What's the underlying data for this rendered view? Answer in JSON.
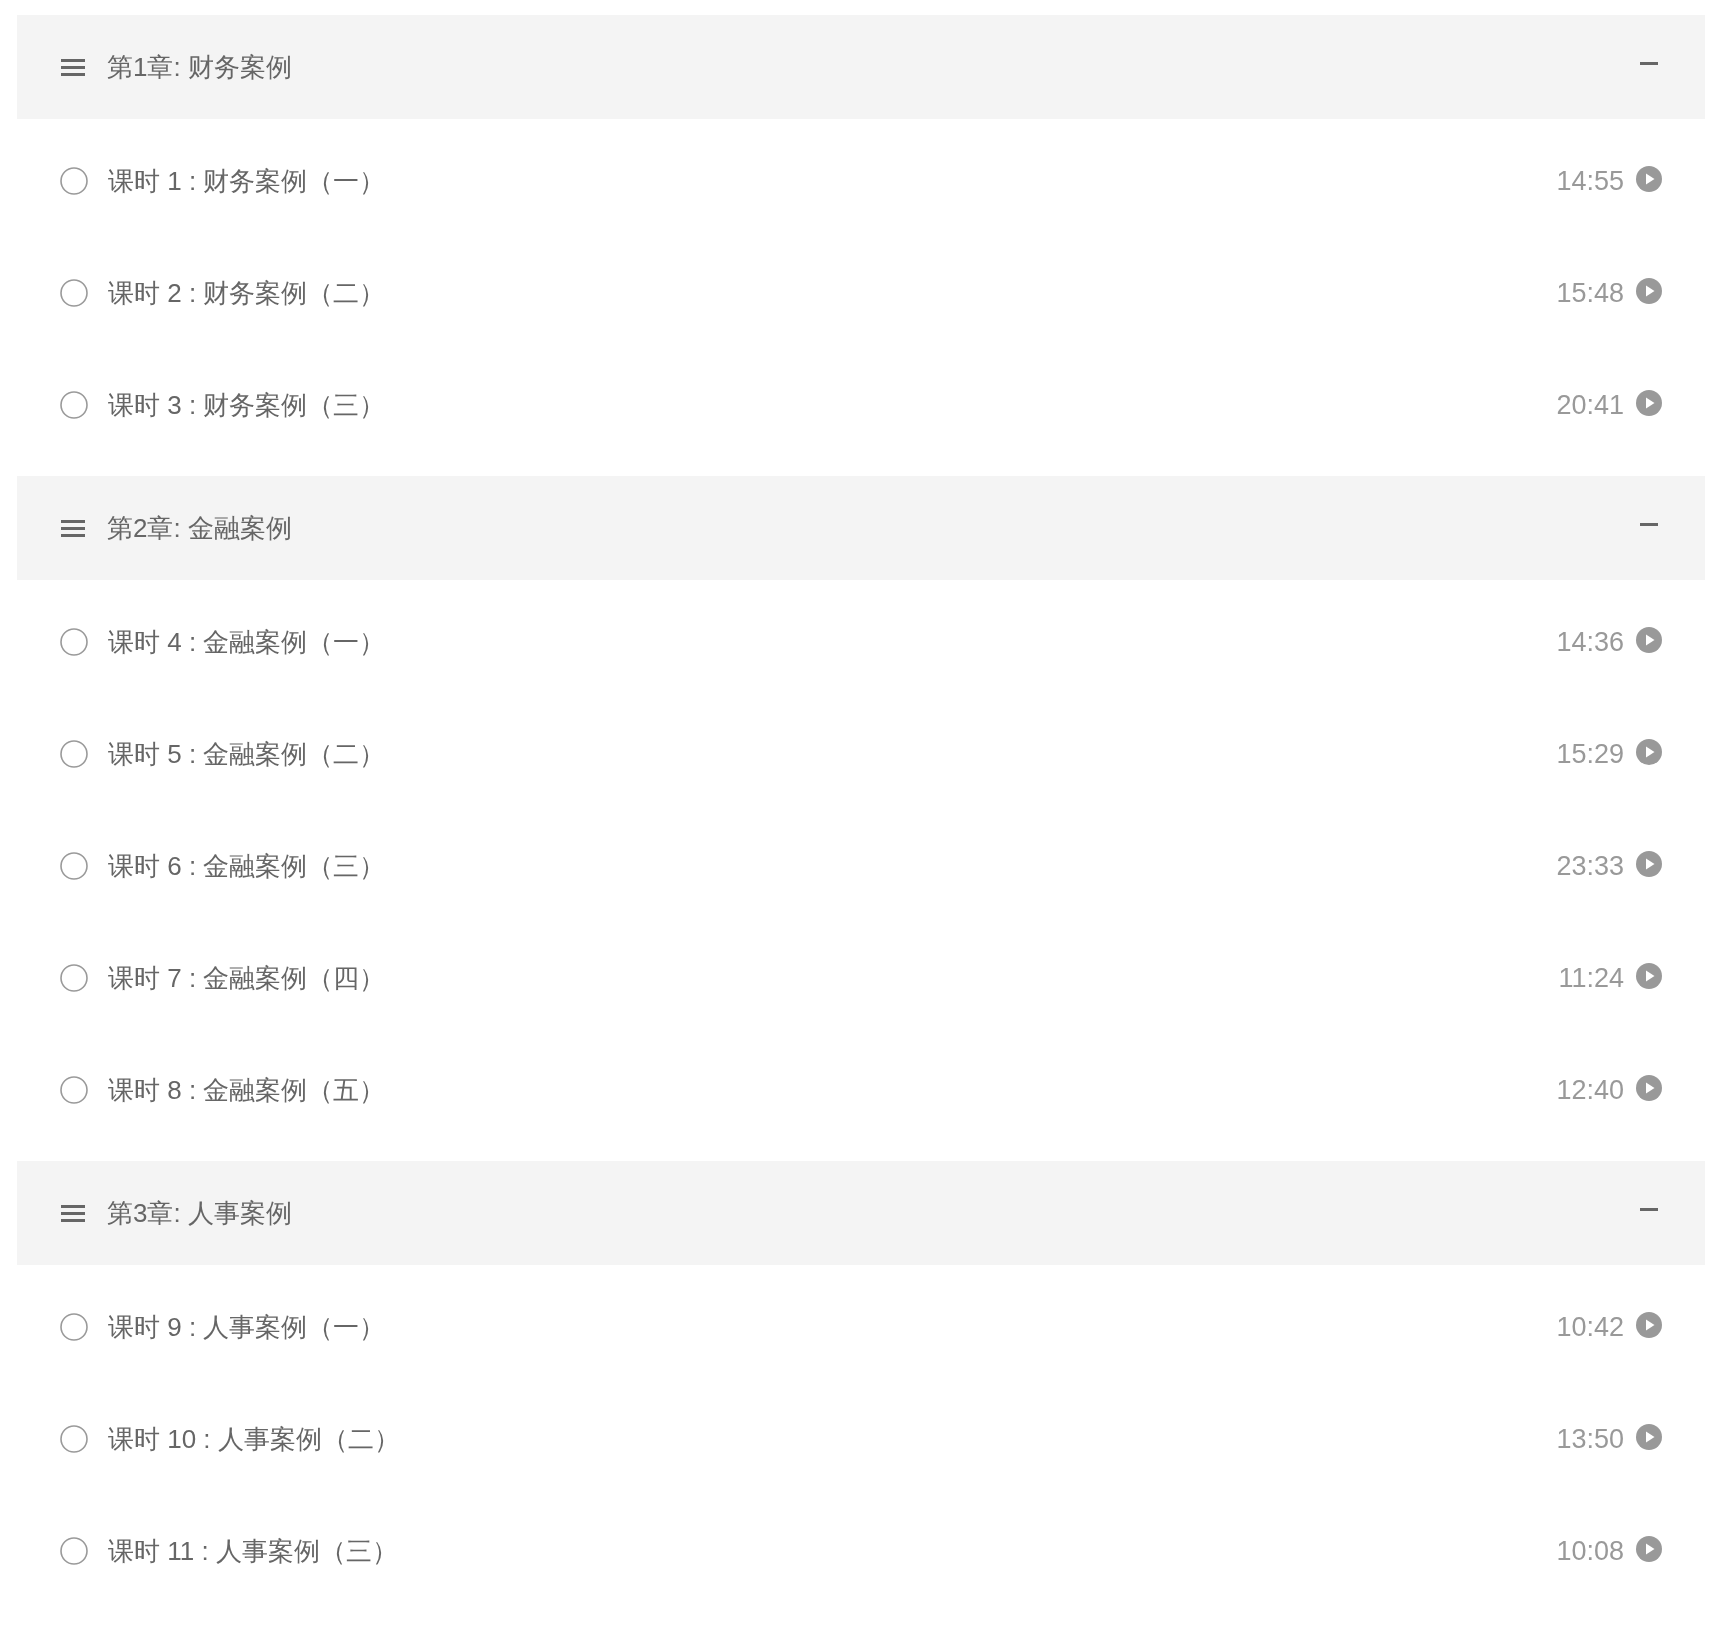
{
  "chapters": [
    {
      "title": "第1章: 财务案例",
      "expanded": true,
      "lessons": [
        {
          "title": "课时 1 : 财务案例（一）",
          "duration": "14:55",
          "completed": false
        },
        {
          "title": "课时 2 : 财务案例（二）",
          "duration": "15:48",
          "completed": false
        },
        {
          "title": "课时 3 : 财务案例（三）",
          "duration": "20:41",
          "completed": false
        }
      ]
    },
    {
      "title": "第2章: 金融案例",
      "expanded": true,
      "lessons": [
        {
          "title": "课时 4 : 金融案例（一）",
          "duration": "14:36",
          "completed": false
        },
        {
          "title": "课时 5 : 金融案例（二）",
          "duration": "15:29",
          "completed": false
        },
        {
          "title": "课时 6 : 金融案例（三）",
          "duration": "23:33",
          "completed": false
        },
        {
          "title": "课时 7 : 金融案例（四）",
          "duration": "11:24",
          "completed": false
        },
        {
          "title": "课时 8 : 金融案例（五）",
          "duration": "12:40",
          "completed": false
        }
      ]
    },
    {
      "title": "第3章: 人事案例",
      "expanded": true,
      "lessons": [
        {
          "title": "课时 9 : 人事案例（一）",
          "duration": "10:42",
          "completed": false
        },
        {
          "title": "课时 10 : 人事案例（二）",
          "duration": "13:50",
          "completed": false
        },
        {
          "title": "课时 11 : 人事案例（三）",
          "duration": "10:08",
          "completed": false
        }
      ]
    }
  ]
}
